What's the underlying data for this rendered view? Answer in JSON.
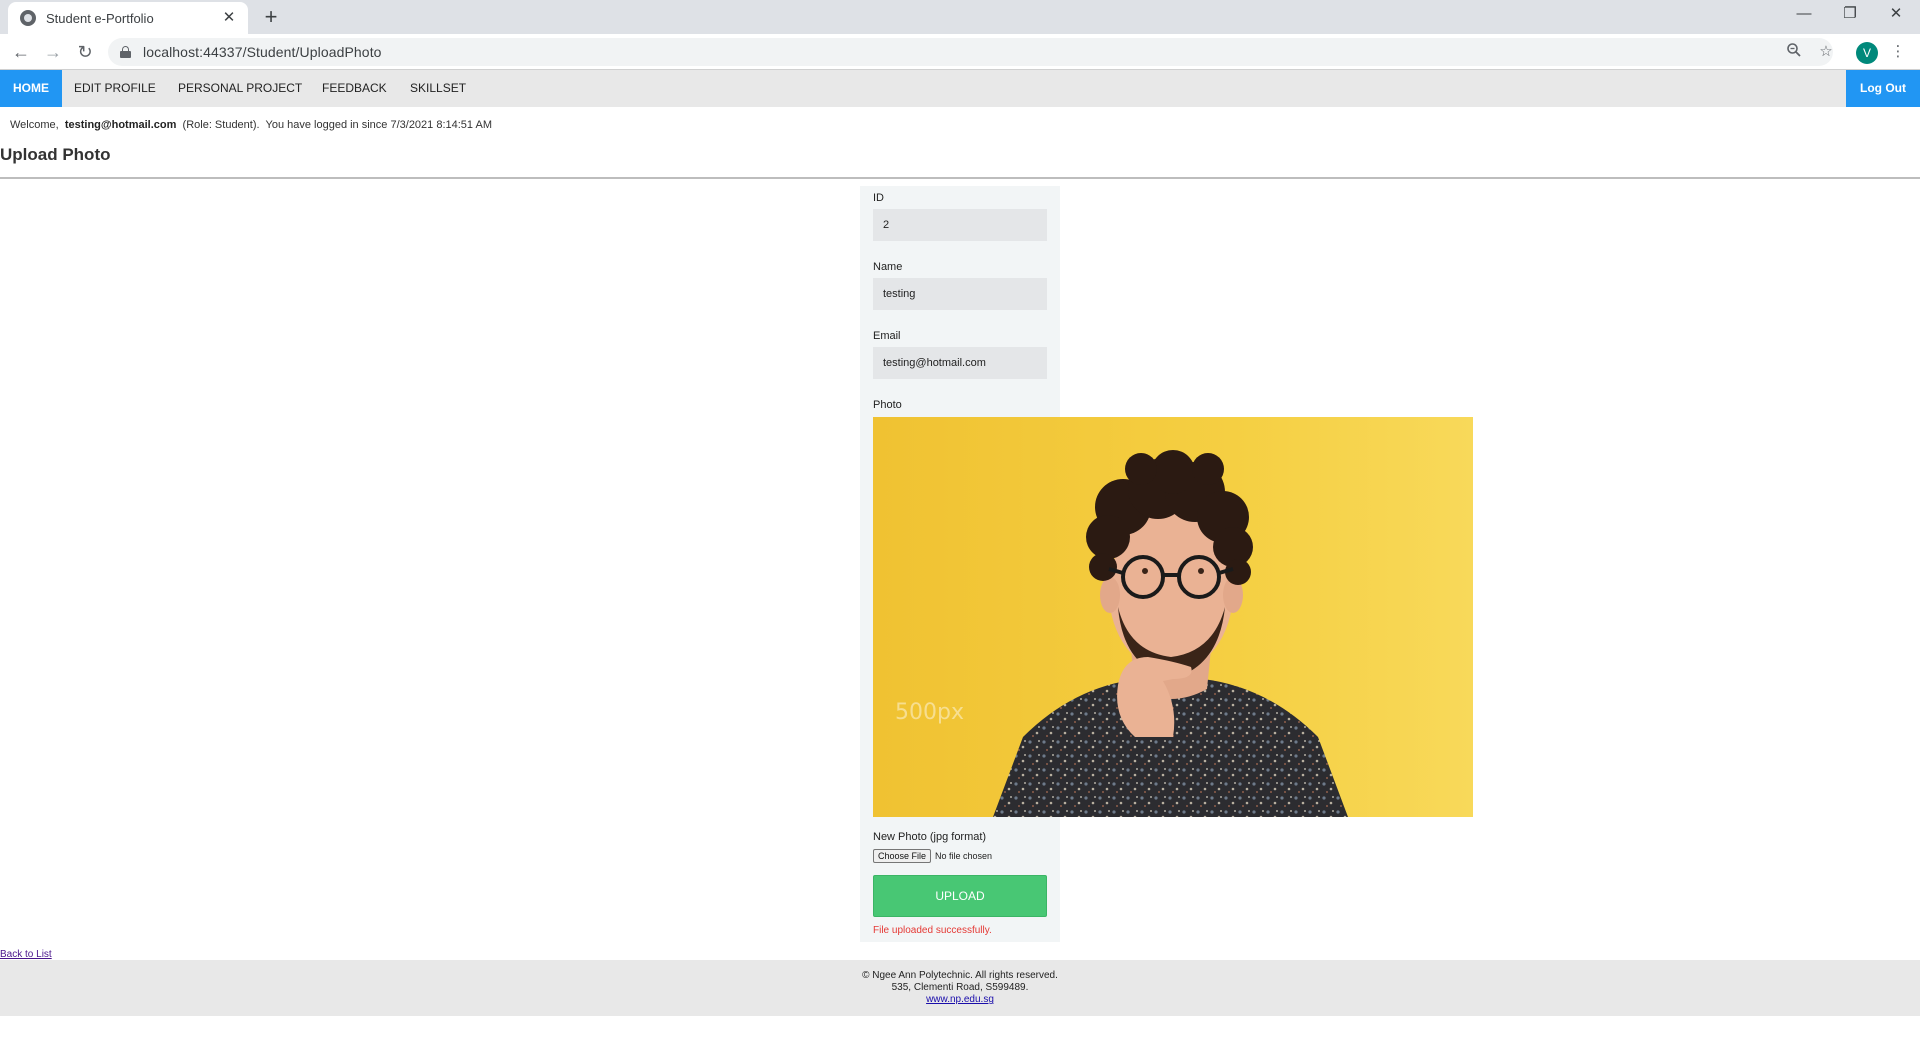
{
  "browser": {
    "tab_title": "Student e-Portfolio",
    "tab_close": "✕",
    "new_tab": "+",
    "url": "localhost:44337/Student/UploadPhoto",
    "profile_initial": "V"
  },
  "nav": {
    "items": [
      "HOME",
      "EDIT PROFILE",
      "PERSONAL PROJECT",
      "FEEDBACK",
      "SKILLSET"
    ],
    "active": "HOME",
    "logout": "Log Out",
    "accent": "#2196f3"
  },
  "welcome": {
    "prefix": "Welcome,",
    "user": "testing@hotmail.com",
    "role": "(Role: Student).",
    "since": "You have logged in since 7/3/2021 8:14:51 AM"
  },
  "page_title": "Upload Photo",
  "form": {
    "id_label": "ID",
    "id_value": "2",
    "name_label": "Name",
    "name_value": "testing",
    "email_label": "Email",
    "email_value": "testing@hotmail.com",
    "photo_label": "Photo",
    "photo_watermark": "500px",
    "new_photo_label": "New Photo (jpg format)",
    "choose_file": "Choose File",
    "no_file": "No file chosen",
    "upload": "UPLOAD",
    "success": "File uploaded successfully."
  },
  "back_link": "Back to List",
  "footer": {
    "copyright": "© Ngee Ann Polytechnic. All rights reserved.",
    "address": "535, Clementi Road, S599489.",
    "link": "www.np.edu.sg"
  }
}
